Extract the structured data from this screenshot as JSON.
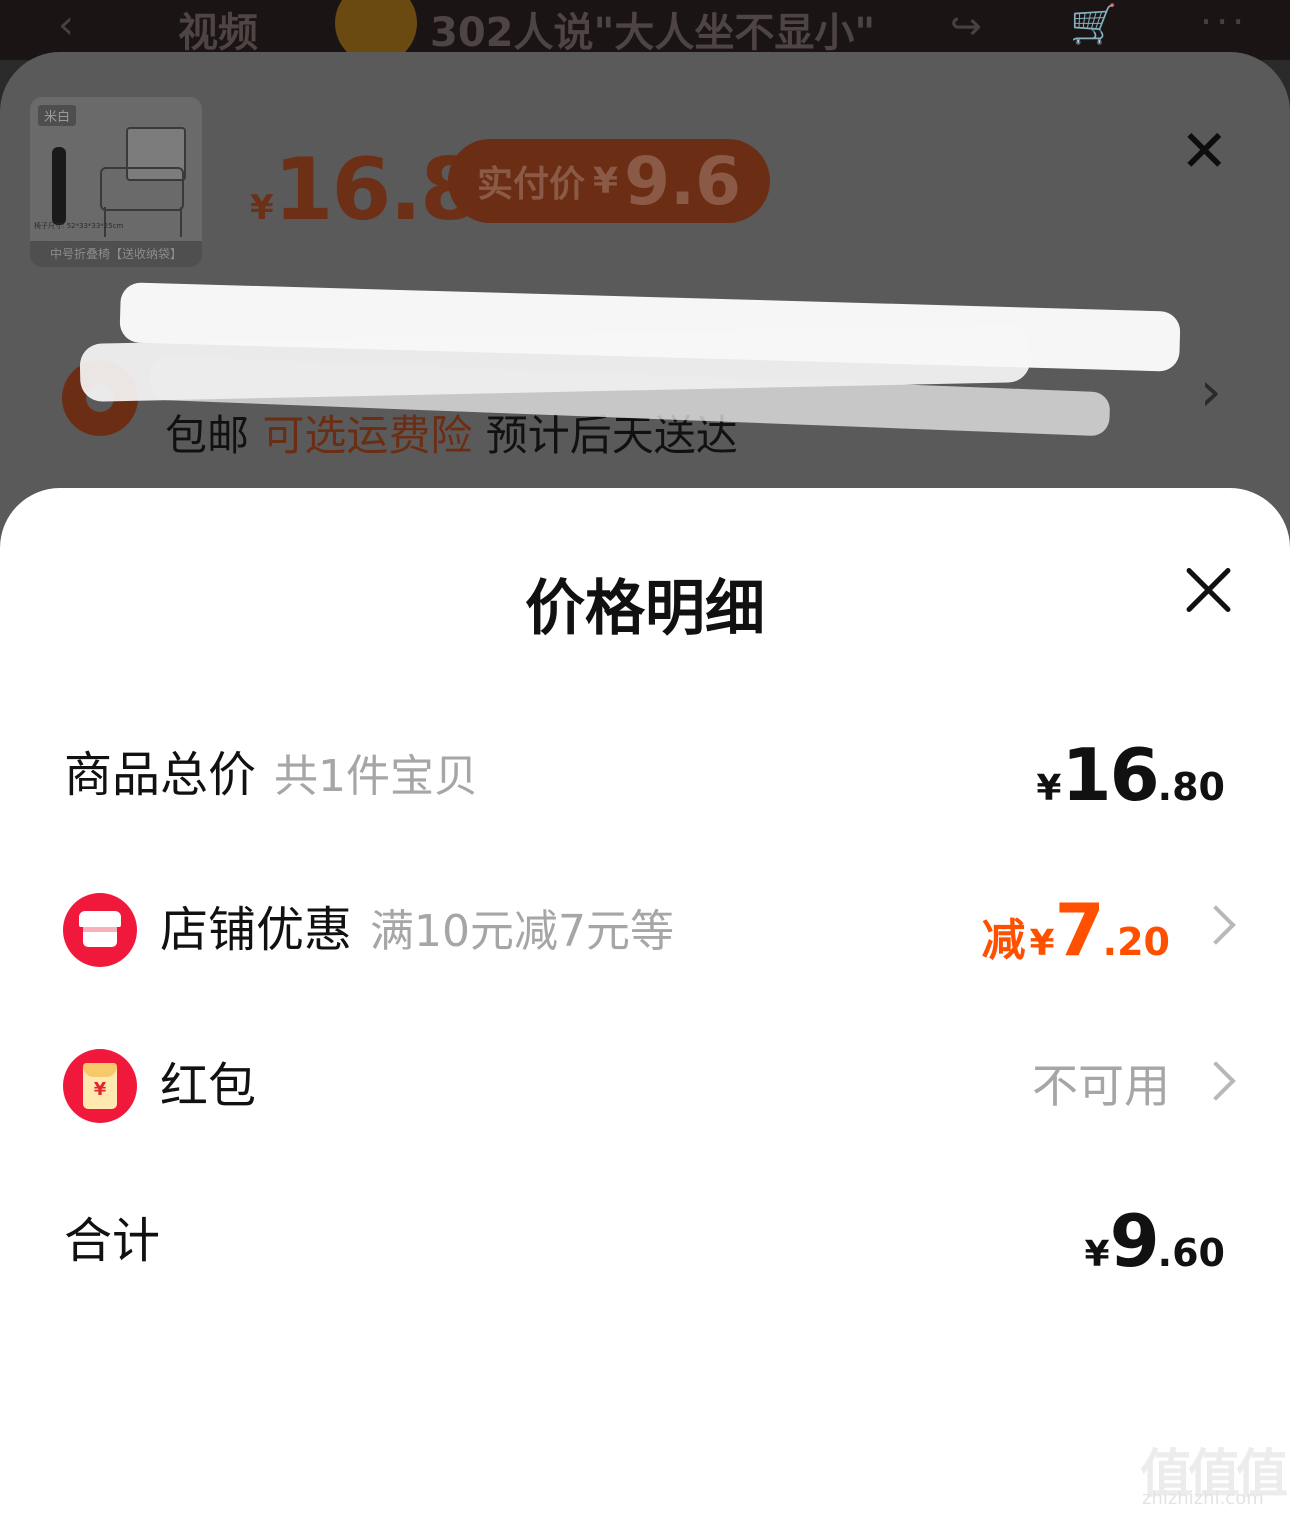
{
  "topbar": {
    "back_glyph": "‹",
    "tab_label": "视频",
    "ticker_text": "302人说\"大人坐不显小\"",
    "share_glyph": "↪",
    "cart_glyph": "🛒",
    "more_glyph": "···"
  },
  "sku_sheet": {
    "thumb_color_tag": "米白",
    "thumb_size_note": "椅子尺寸:\n52*33*33*25cm",
    "thumb_caption": "中号折叠椅【送收纳袋】",
    "price_currency": "¥",
    "price_value": "16.8",
    "paid_label": "实付价",
    "paid_currency": "¥",
    "paid_value": "9.6",
    "close_glyph": "✕",
    "ship_free": "包邮",
    "ship_insurance": "可选运费险",
    "ship_eta": "预计后天送达",
    "chevron_glyph": "›"
  },
  "price_detail": {
    "title": "价格明细",
    "rows": [
      {
        "label": "商品总价",
        "sub": "共1件宝贝",
        "currency": "¥",
        "int": "16",
        "dec": ".80"
      },
      {
        "icon": "shop-icon",
        "label": "店铺优惠",
        "sub": "满10元减7元等",
        "prefix": "减",
        "currency": "¥",
        "int": "7",
        "dec": ".20"
      },
      {
        "icon": "red-packet-icon",
        "label": "红包",
        "packet_symbol": "¥",
        "status": "不可用"
      },
      {
        "label": "合计",
        "currency": "¥",
        "int": "9",
        "dec": ".60"
      }
    ]
  },
  "watermark": {
    "text": "值值值",
    "url": "zhizhizhi.com"
  },
  "colors": {
    "accent_orange": "#ff5000",
    "icon_red": "#f0193b",
    "muted_gray": "#a6a6a6"
  }
}
